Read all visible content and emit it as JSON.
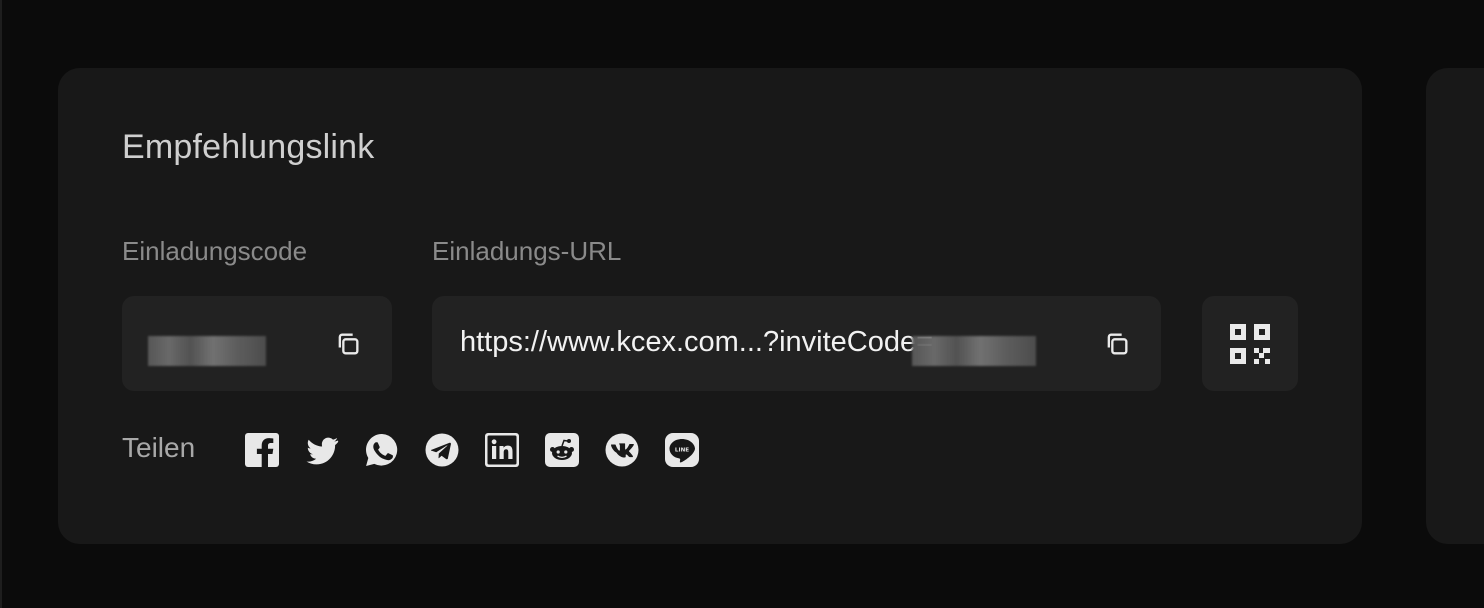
{
  "card": {
    "title": "Empfehlungslink",
    "invite_code_label": "Einladungscode",
    "invite_url_label": "Einladungs-URL",
    "invite_url_value": "https://www.kcex.com...?inviteCode=",
    "share_label": "Teilen",
    "share_icons": [
      "facebook-icon",
      "twitter-icon",
      "whatsapp-icon",
      "telegram-icon",
      "linkedin-icon",
      "reddit-icon",
      "vk-icon",
      "line-icon"
    ]
  },
  "colors": {
    "page_bg": "#0b0b0b",
    "card_bg": "#181818",
    "field_bg": "#222222",
    "title_text": "#cfcfcf",
    "label_text": "#8a8a8a",
    "value_text": "#f2f2f2",
    "icon": "#e8e8e8"
  }
}
